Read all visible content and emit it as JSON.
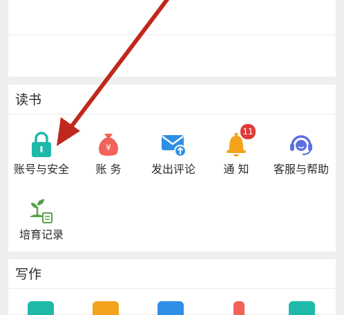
{
  "sections": {
    "read": {
      "title": "读书",
      "items": [
        {
          "label": "账号与安全",
          "icon": "lock-icon",
          "color": "#1fb9a9"
        },
        {
          "label": "账  务",
          "icon": "money-bag-icon",
          "color": "#f1625b"
        },
        {
          "label": "发出评论",
          "icon": "mail-upload-icon",
          "color": "#2f8fe6"
        },
        {
          "label": "通  知",
          "icon": "bell-icon",
          "color": "#f4a31d",
          "badge": "11"
        },
        {
          "label": "客服与帮助",
          "icon": "headset-icon",
          "color": "#5a6fe0"
        },
        {
          "label": "培育记录",
          "icon": "plant-icon",
          "color": "#5aa04a"
        }
      ]
    },
    "write": {
      "title": "写作"
    }
  },
  "colors": {
    "annotation_arrow": "#c0281e",
    "badge": "#e03a3a"
  }
}
